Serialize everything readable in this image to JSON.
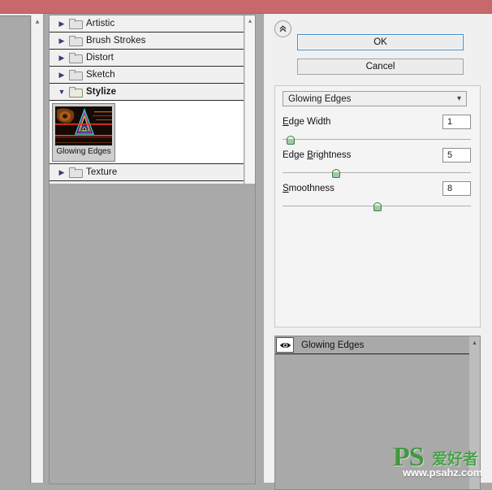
{
  "window": {
    "titlebar_color": "#c9686c"
  },
  "preview": {
    "name": "preview-pane",
    "scroll_up_icon": "chevron-up-icon"
  },
  "browser": {
    "categories": [
      {
        "label": "Artistic",
        "expanded": false,
        "icon": "folder-icon",
        "arrow": "triangle-right-icon"
      },
      {
        "label": "Brush Strokes",
        "expanded": false,
        "icon": "folder-icon",
        "arrow": "triangle-right-icon"
      },
      {
        "label": "Distort",
        "expanded": false,
        "icon": "folder-icon",
        "arrow": "triangle-right-icon"
      },
      {
        "label": "Sketch",
        "expanded": false,
        "icon": "folder-icon",
        "arrow": "triangle-right-icon"
      },
      {
        "label": "Stylize",
        "expanded": true,
        "icon": "folder-open-icon",
        "arrow": "triangle-down-icon"
      },
      {
        "label": "Texture",
        "expanded": false,
        "icon": "folder-icon",
        "arrow": "triangle-right-icon"
      }
    ],
    "thumbnails": [
      {
        "label": "Glowing Edges",
        "selected": true
      }
    ],
    "scroll_up_icon": "chevron-up-icon"
  },
  "controls": {
    "collapse_icon": "double-chevron-up-icon",
    "ok_label": "OK",
    "cancel_label": "Cancel",
    "filter_select": {
      "value": "Glowing Edges",
      "caret_icon": "chevron-down-icon"
    },
    "sliders": [
      {
        "label_pre": "E",
        "label_post": "dge Width",
        "mnemonic": "E",
        "value": "1",
        "percent": 4
      },
      {
        "label_pre": "Edge ",
        "label_post": "rightness",
        "mnemonic": "B",
        "value": "5",
        "percent": 28
      },
      {
        "label_pre": "",
        "label_post": "moothness",
        "mnemonic": "S",
        "value": "8",
        "percent": 50
      }
    ]
  },
  "effect_stack": {
    "rows": [
      {
        "label": "Glowing Edges",
        "visible": true,
        "eye_icon": "eye-icon"
      }
    ],
    "scroll_up_icon": "chevron-up-icon"
  },
  "watermark": {
    "brand": "PS",
    "brand_cn": "爱好者",
    "url": "www.psahz.com",
    "color": "#3f9a3f"
  }
}
